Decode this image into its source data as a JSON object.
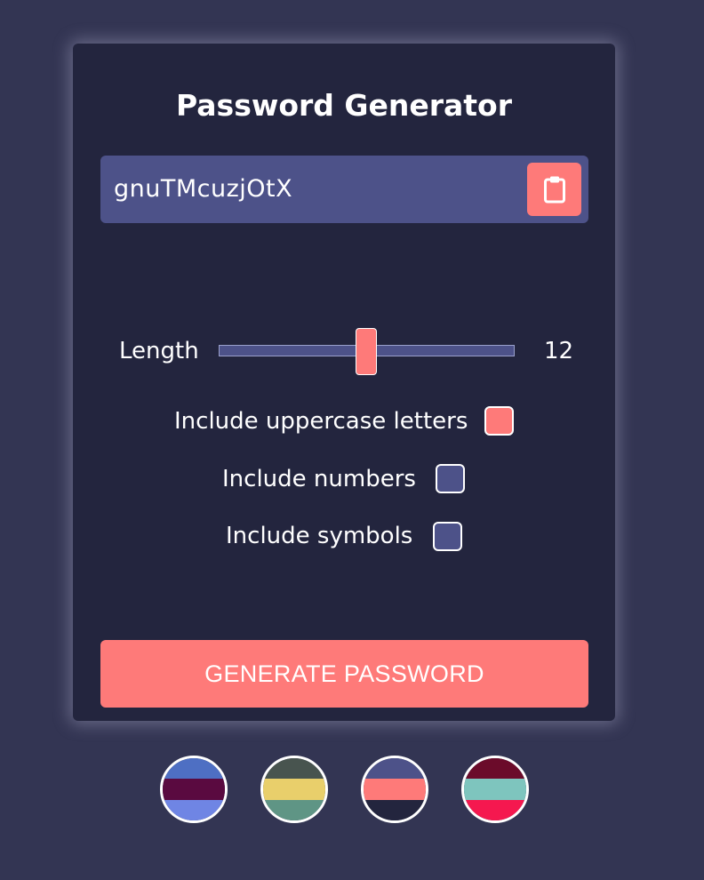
{
  "app": {
    "title": "Password Generator"
  },
  "password": {
    "value": "gnuTMcuzjOtX",
    "copy_icon": "clipboard-icon"
  },
  "length": {
    "label": "Length",
    "value": "12",
    "min": 4,
    "max": 20
  },
  "options": [
    {
      "label": "Include uppercase letters",
      "checked": true
    },
    {
      "label": "Include numbers",
      "checked": false
    },
    {
      "label": "Include symbols",
      "checked": false
    }
  ],
  "generate_button": {
    "label": "GENERATE PASSWORD"
  },
  "themes": [
    {
      "name": "theme-1",
      "colors": [
        "#4e6fc3",
        "#5a0a40",
        "#6f85e4"
      ]
    },
    {
      "name": "theme-2",
      "colors": [
        "#48544f",
        "#e9cf6b",
        "#5f9585"
      ]
    },
    {
      "name": "theme-3",
      "colors": [
        "#4d5289",
        "#fe7a79",
        "#23253e"
      ]
    },
    {
      "name": "theme-4",
      "colors": [
        "#6b0b2a",
        "#7ec5be",
        "#f5184f"
      ]
    }
  ],
  "colors": {
    "background": "#333553",
    "card": "#23253e",
    "accent": "#fe7a79",
    "input": "#4d5289"
  }
}
